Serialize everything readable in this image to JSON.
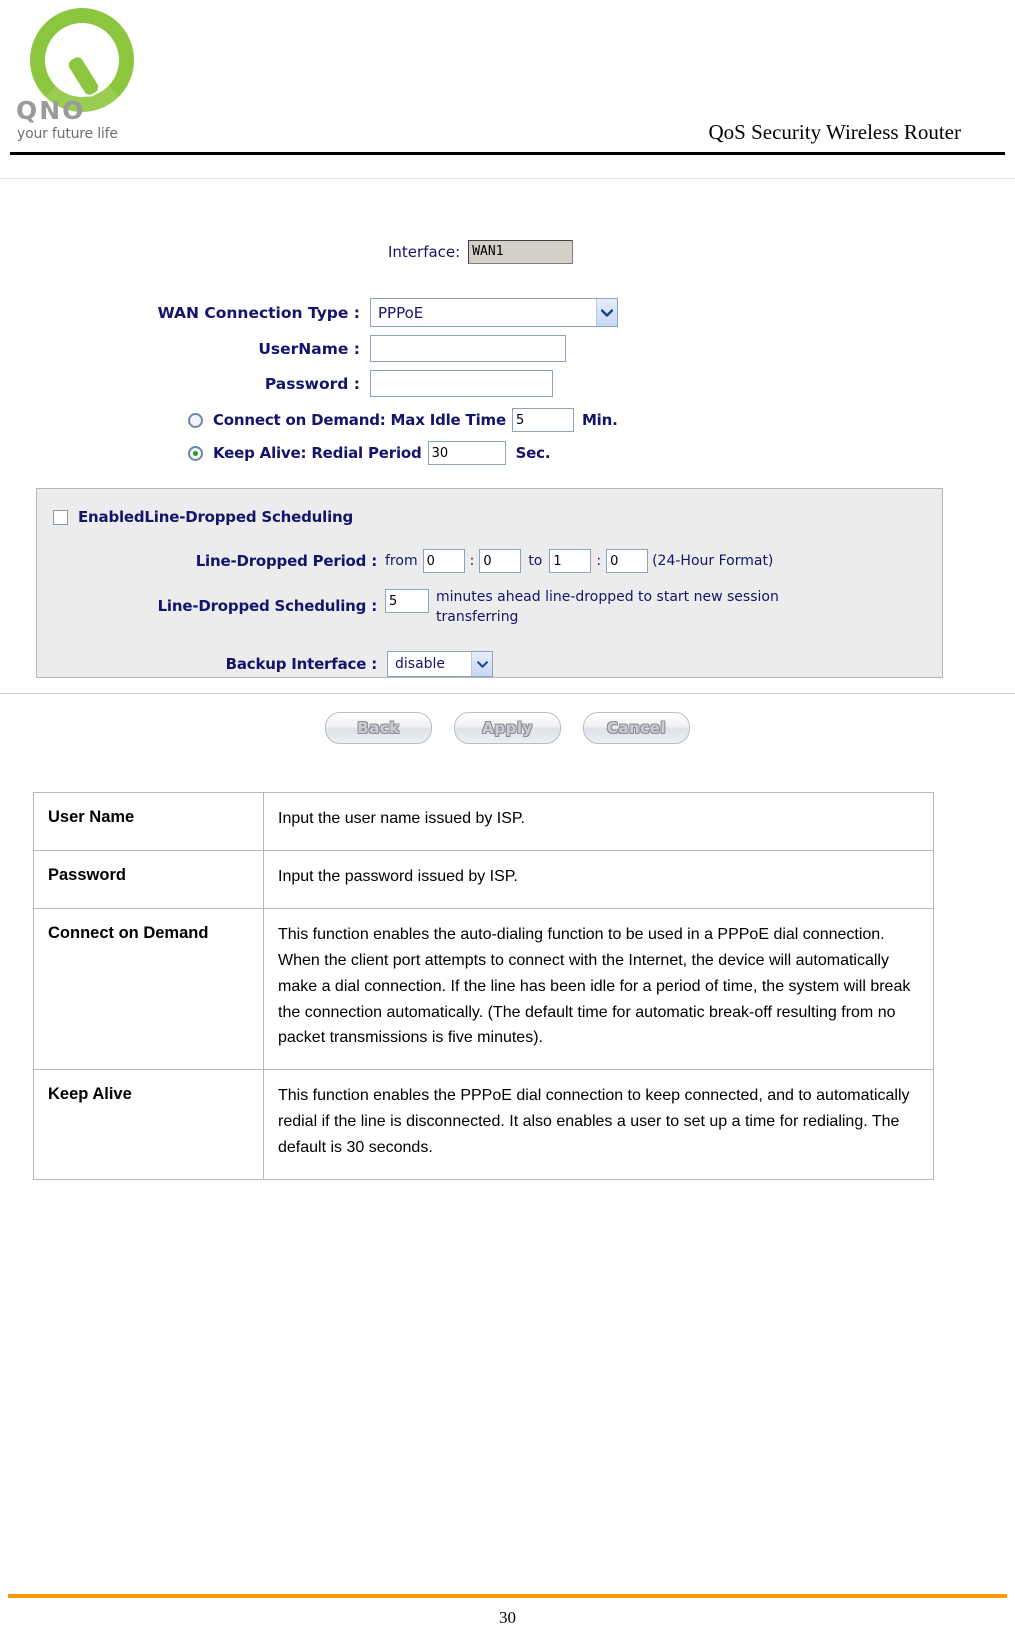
{
  "header": {
    "title": "QoS Security Wireless Router",
    "logo_word": "QNO",
    "logo_tagline": "your future life"
  },
  "screenshot": {
    "interface": {
      "label": "Interface:",
      "value": "WAN1"
    },
    "wan_connection_type": {
      "label": "WAN  Connection Type :",
      "value": "PPPoE"
    },
    "username": {
      "label": "UserName :",
      "value": "",
      "placeholder": ""
    },
    "password": {
      "label": "Password :",
      "value": "",
      "placeholder": ""
    },
    "connect_on_demand": {
      "label": "Connect on Demand: Max Idle Time",
      "value": "5",
      "unit": "Min.",
      "selected": false
    },
    "keep_alive": {
      "label": "Keep Alive: Redial Period",
      "value": "30",
      "unit": "Sec.",
      "selected": true
    },
    "scheduling": {
      "enable_label": "EnabledLine-Dropped Scheduling",
      "enabled": false,
      "period_label": "Line-Dropped Period :",
      "from_word": "from",
      "to_word": "to",
      "from_hour": "0",
      "from_min": "0",
      "to_hour": "1",
      "to_min": "0",
      "format_note": "(24-Hour Format)",
      "sched_label": "Line-Dropped Scheduling :",
      "sched_value": "5",
      "sched_note_line1": "minutes ahead line-dropped to start new session",
      "sched_note_line2": "transferring",
      "backup_label": "Backup Interface :",
      "backup_value": "disable"
    },
    "buttons": {
      "back": "Back",
      "apply": "Apply",
      "cancel": "Cancel"
    }
  },
  "table": {
    "rows": [
      {
        "key": "User Name",
        "value": "Input the user name issued by ISP."
      },
      {
        "key": "Password",
        "value": "Input the password issued by ISP."
      },
      {
        "key": "Connect on Demand",
        "value": "This function enables the auto-dialing function to be used in a PPPoE dial connection. When the client port attempts to connect with the Internet, the device will automatically make a dial connection. If the line has been idle for a period of time, the system will break the connection automatically. (The default time for automatic break-off resulting from no packet transmissions is five minutes)."
      },
      {
        "key": "Keep Alive",
        "value": "This function enables the PPPoE dial connection to keep connected, and to automatically redial if the line is disconnected. It also enables a user to set up a time for redialing. The default is 30 seconds."
      }
    ]
  },
  "footer": {
    "page_number": "30"
  },
  "colors": {
    "accent_orange": "#f79a08",
    "logo_green": "#8cc63e",
    "form_label_blue": "#14146b",
    "panel_gray": "#ececec"
  }
}
